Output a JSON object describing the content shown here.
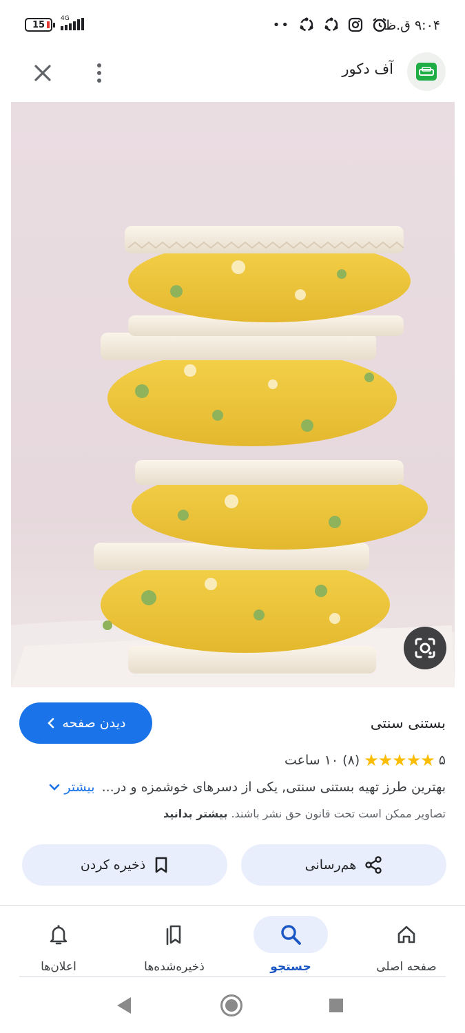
{
  "status_bar": {
    "time": "۹:۰۴ ق.ظ",
    "battery_level": "15",
    "network": "4G",
    "icons": [
      "alarm-icon",
      "instagram-icon",
      "sync-icon",
      "sync-icon",
      "more-dots"
    ]
  },
  "header": {
    "site_name": "آف دکور",
    "logo_icon": "sofa-icon"
  },
  "image": {
    "subject": "ice-cream-wafer-sandwiches"
  },
  "details": {
    "visit_button_label": "دیدن صفحه",
    "title": "بستنی سنتی",
    "rating_value": "۵",
    "rating_stars": 5,
    "review_count": "(۸)",
    "duration": "۱۰ ساعت",
    "description": "بهترین طرز تهیه بستنی سنتی, یکی از دسرهای خوشمزه و در...",
    "more_label": "بیشتر",
    "copyright_text": "تصاویر ممکن است تحت قانون حق نشر باشند.",
    "copyright_link": "بیشتر بدانید"
  },
  "actions": {
    "share_label": "هم‌رسانی",
    "save_label": "ذخیره کردن"
  },
  "bottom_nav": {
    "home_label": "صفحه اصلی",
    "search_label": "جستجو",
    "saved_label": "ذخیره‌شده‌ها",
    "notifications_label": "اعلان‌ها",
    "active": "search"
  },
  "colors": {
    "accent": "#1a73e8",
    "pill_bg": "#e8eefb",
    "star": "#fbbc04",
    "logo_green": "#1fae45"
  }
}
